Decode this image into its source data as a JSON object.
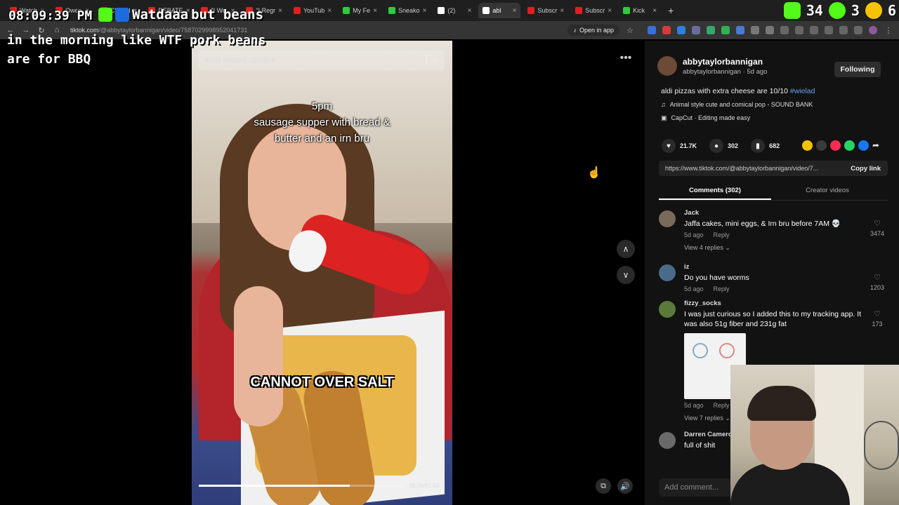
{
  "browser": {
    "tabs": [
      {
        "label": "Watch",
        "color": "#e02020"
      },
      {
        "label": "Owen",
        "color": "#e02020"
      },
      {
        "label": "Clifford",
        "color": "#e02020"
      },
      {
        "label": "DEBATE",
        "color": "#e02020"
      },
      {
        "label": "\"I Wo",
        "color": "#e02020"
      },
      {
        "label": "\"I Regr",
        "color": "#e02020"
      },
      {
        "label": "YouTub",
        "color": "#e02020"
      },
      {
        "label": "My Fe",
        "color": "#2ecc40"
      },
      {
        "label": "Sneako",
        "color": "#2ecc40"
      },
      {
        "label": "(2)",
        "color": "#ffffff"
      },
      {
        "label": "abl",
        "color": "#ffffff",
        "active": true
      },
      {
        "label": "Subscr",
        "color": "#e02020"
      },
      {
        "label": "Subscr",
        "color": "#e02020"
      },
      {
        "label": "Kick",
        "color": "#2ecc40"
      }
    ],
    "url_domain": "tiktok.com",
    "url_path": "/@abbytaylorbannigan/video/7587029998952041731",
    "open_in_app": "Open in app"
  },
  "overlay": {
    "clock": "08:09:39 PM",
    "chat_user": "Watdaaa",
    "chat_text": "but beans",
    "caption": "in the morning like WTF pork beans\nare for BBQ",
    "counter_a": "34",
    "counter_b": "3",
    "counter_c": "6",
    "kick_color": "#53fc18"
  },
  "video": {
    "search_placeholder": "Find related content",
    "text_line1": "5pm",
    "text_line2": "sausage supper with bread &",
    "text_line3": "butter and an irn bru",
    "big_caption": "CANNOT OVER SALT",
    "progress": 0.74,
    "timecode": "01:26/01:54"
  },
  "creator": {
    "username": "abbytaylorbannigan",
    "sub": "abbytaylorbannigan · 5d ago",
    "follow_label": "Following",
    "description": "aldi pizzas with extra cheese are 10/10 ",
    "hashtag": "#wielad",
    "music": "Animal style cute and comical pop - SOUND BANK",
    "capcut": "CapCut · Editing made easy"
  },
  "stats": {
    "likes": "21.7K",
    "comments": "302",
    "saves": "682"
  },
  "share": {
    "link": "https://www.tiktok.com/@abbytaylorbannigan/video/7...",
    "copy_label": "Copy link",
    "colors": [
      "#f2c200",
      "#3a3a3a",
      "#fe2c55",
      "#25d366",
      "#1877f2"
    ]
  },
  "tabs": {
    "comments": "Comments (302)",
    "creator_videos": "Creator videos"
  },
  "comments": [
    {
      "user": "Jack",
      "text": "Jaffa cakes, mini eggs, & Irn bru before 7AM 💀",
      "time": "5d ago",
      "reply": "Reply",
      "likes": "3474",
      "view_replies": "View 4 replies ⌄",
      "avatar_color": "#7a6a5a"
    },
    {
      "user": "iz",
      "text": "Do you have worms",
      "time": "5d ago",
      "reply": "Reply",
      "likes": "1203",
      "view_replies": "",
      "avatar_color": "#4a6a8a"
    },
    {
      "user": "fizzy_socks",
      "text": "I was just curious so I added this to my tracking app. It was also 51g fiber and 231g fat",
      "time": "5d ago",
      "reply": "Reply",
      "likes": "173",
      "view_replies": "View 7 replies ⌄",
      "avatar_color": "#5a7a3a"
    },
    {
      "user": "Darren Cameron",
      "text": "full of shit",
      "time": "",
      "reply": "",
      "likes": "",
      "view_replies": "",
      "avatar_color": "#6a6a6a"
    }
  ],
  "add_comment_placeholder": "Add comment..."
}
